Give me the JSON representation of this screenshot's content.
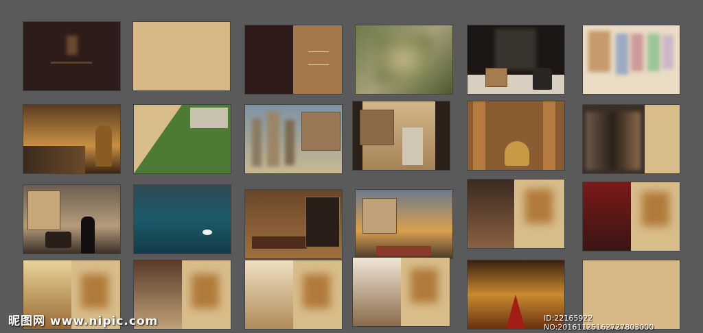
{
  "watermark": {
    "text": "昵图网 www.nipic.com",
    "id_text": "ID:22165922 NO:20161125162727803000"
  },
  "colors": {
    "background": "#5a5a5a",
    "paper": "#d8b886",
    "dark_brown": "#2c1c1a",
    "gold": "#b8843a"
  },
  "thumbnails": [
    {
      "name": "dark-cover"
    },
    {
      "name": "tan-cover"
    },
    {
      "name": "split-cover"
    },
    {
      "name": "blurred-garden"
    },
    {
      "name": "dark-lobby"
    },
    {
      "name": "color-bars"
    },
    {
      "name": "golden-statue"
    },
    {
      "name": "garden-diagonal"
    },
    {
      "name": "towers-sky"
    },
    {
      "name": "tower-gate"
    },
    {
      "name": "classical-hall"
    },
    {
      "name": "figures-dark"
    },
    {
      "name": "carriage-scene"
    },
    {
      "name": "lake-swan"
    },
    {
      "name": "living-room"
    },
    {
      "name": "arch-sunset"
    },
    {
      "name": "interior-room"
    },
    {
      "name": "red-interior"
    },
    {
      "name": "bedroom"
    },
    {
      "name": "chandelier-room"
    },
    {
      "name": "bright-living"
    },
    {
      "name": "fireplace-room"
    },
    {
      "name": "red-carpet-hall"
    },
    {
      "name": "tan-back-cover"
    }
  ]
}
